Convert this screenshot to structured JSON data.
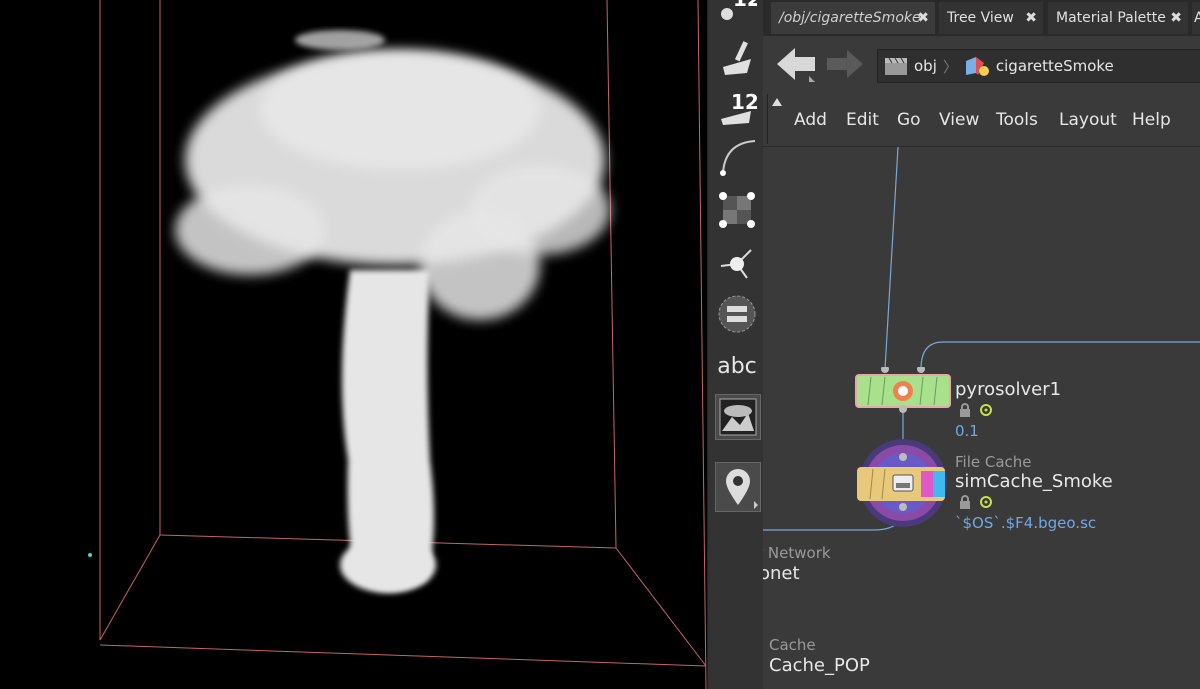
{
  "shelf": {
    "tools": [
      {
        "icon": "poly-count-icon",
        "badge": "12"
      },
      {
        "icon": "draw-curve-icon"
      },
      {
        "icon": "poly-count-icon",
        "badge": "12"
      },
      {
        "icon": "bezier-curve-icon"
      },
      {
        "icon": "checker-grid-icon"
      },
      {
        "icon": "skeleton-joint-icon"
      },
      {
        "icon": "disk-layer-icon"
      },
      {
        "icon": "text-tool-icon",
        "label": "abc"
      },
      {
        "icon": "image-mountain-icon"
      },
      {
        "icon": "location-pin-icon"
      }
    ]
  },
  "tabs": [
    {
      "label": "/obj/cigaretteSmoke",
      "close": "✖"
    },
    {
      "label": "Tree View",
      "close": "✖"
    },
    {
      "label": "Material Palette",
      "close": "✖"
    },
    {
      "label": "A"
    }
  ],
  "path": {
    "root": "obj",
    "current": "cigaretteSmoke"
  },
  "menu": [
    "Add",
    "Edit",
    "Go",
    "View",
    "Tools",
    "Layout",
    "Help"
  ],
  "nodes": {
    "pyrosolver": {
      "name": "pyrosolver1",
      "value": "0.1"
    },
    "filecache": {
      "type": "File Cache",
      "name": "simCache_Smoke",
      "value": "`$OS`.$F4.bgeo.sc"
    },
    "network": {
      "type": "r Network",
      "name": "onet"
    },
    "popcache": {
      "type": "Cache",
      "name": "Cache_POP"
    }
  },
  "colors": {
    "viewport_bg": "#000000",
    "bbox_line": "#c86464",
    "smoke": "#e8e8e8",
    "pane_bg": "#3a3a3a",
    "wire": "#7aa8d6",
    "solver_node": "#a8e08c",
    "cache_node": "#e8c87a",
    "value_text": "#6fa8e6"
  }
}
